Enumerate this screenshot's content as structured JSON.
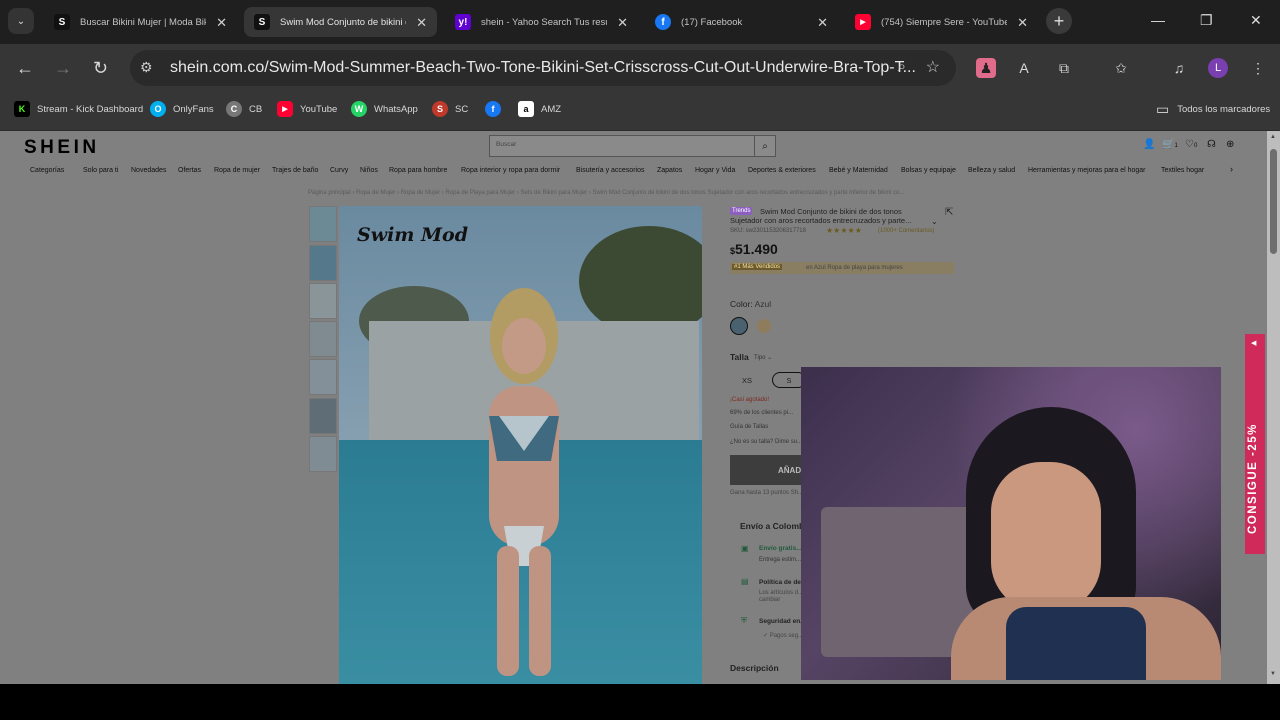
{
  "tabs": [
    {
      "title": "Buscar Bikini Mujer | Moda Bikini",
      "favicon": "S",
      "favcolor": "#111111",
      "active": false
    },
    {
      "title": "Swim Mod Conjunto de bikini de",
      "favicon": "S",
      "favcolor": "#111111",
      "active": true
    },
    {
      "title": "shein - Yahoo Search Tus resultados",
      "favicon": "y!",
      "favcolor": "#5f01d1",
      "active": false
    },
    {
      "title": "(17) Facebook",
      "favicon": "f",
      "favcolor": "#1877f2",
      "active": false
    },
    {
      "title": "(754) Siempre Sere - YouTube",
      "favicon": "▶",
      "favcolor": "#ff0033",
      "active": false
    }
  ],
  "address": {
    "url": "shein.com.co/Swim-Mod-Summer-Beach-Two-Tone-Bikini-Set-Crisscross-Cut-Out-Underwire-Bra-Top-T..."
  },
  "profile_letter": "L",
  "bookmarks": [
    {
      "label": "Stream - Kick Dashboard",
      "icon": "K",
      "color": "#53fc18"
    },
    {
      "label": "OnlyFans",
      "icon": "O",
      "color": "#00aff0"
    },
    {
      "label": "CB",
      "icon": "C",
      "color": "#777777"
    },
    {
      "label": "YouTube",
      "icon": "▶",
      "color": "#ff0033"
    },
    {
      "label": "WhatsApp",
      "icon": "W",
      "color": "#25d366"
    },
    {
      "label": "SC",
      "icon": "S",
      "color": "#c0392b"
    },
    {
      "label": "",
      "icon": "f",
      "color": "#1877f2"
    },
    {
      "label": "AMZ",
      "icon": "a",
      "color": "#ffffff"
    }
  ],
  "all_bookmarks": "Todos los marcadores",
  "site": {
    "logo": "SHEIN",
    "search_placeholder": "Buscar",
    "cart_count": "1",
    "fav_count": "0",
    "categories": [
      "Categorías",
      "Solo para ti",
      "Novedades",
      "Ofertas",
      "Ropa de mujer",
      "Trajes de baño",
      "Curvy",
      "Niños",
      "Ropa para hombre",
      "Ropa interior y ropa para dormir",
      "Bisutería y accesorios",
      "Zapatos",
      "Hogar y Vida",
      "Deportes & exteriores",
      "Bebé y Maternidad",
      "Bolsas y equipaje",
      "Belleza y salud",
      "Herramientas y mejoras para el hogar",
      "Textiles hogar"
    ],
    "breadcrumb": "Página principal › Ropa de Mujer › Ropa de Mujer › Ropa de Playa para Mujer › Sets de Bikini para Mujer › Swim Mod Conjunto de bikini de dos tonos Sujetador con aros recortados entrecruzados y parte inferior de bikini co..."
  },
  "product": {
    "brand_overlay": "Swim Mod",
    "badge": "Trends",
    "title_line1": "Swim Mod Conjunto de bikini de dos tonos",
    "title_line2": "Sujetador con aros recortados entrecruzados y parte...",
    "sku": "SKU: sw2301153206317718",
    "rating_text": "(1000+ Comentarios)",
    "currency": "$",
    "price": "51.490",
    "bestseller_badge": "#1 Más Vendidos",
    "bestseller_text": "en Azul Ropa de playa para mujeres",
    "color_label": "Color:",
    "color_value": "Azul",
    "size_label": "Talla",
    "size_type": "Tipo",
    "sizes": [
      "XS",
      "S"
    ],
    "stock_note": "¡Casi agotado!",
    "fit_note": "69% de los clientes pi...",
    "size_guide": "Guía de Tallas",
    "find_size": "¿No es su talla? Dime su...",
    "add_button": "AÑAD...",
    "points": "Gana hasta 13 puntos Sh...",
    "shipping_title": "Envío a Colomb...",
    "free_shipping": "Envío gratis...",
    "delivery": "Entrega estim...",
    "policy": "Política de de...",
    "policy_sub1": "Los artículos d...",
    "policy_sub2": "cambiar",
    "security": "Seguridad en...",
    "secure_pay": "✓ Pagos seg...",
    "description": "Descripción"
  },
  "promo": {
    "label": "CONSIGUE -25%"
  }
}
